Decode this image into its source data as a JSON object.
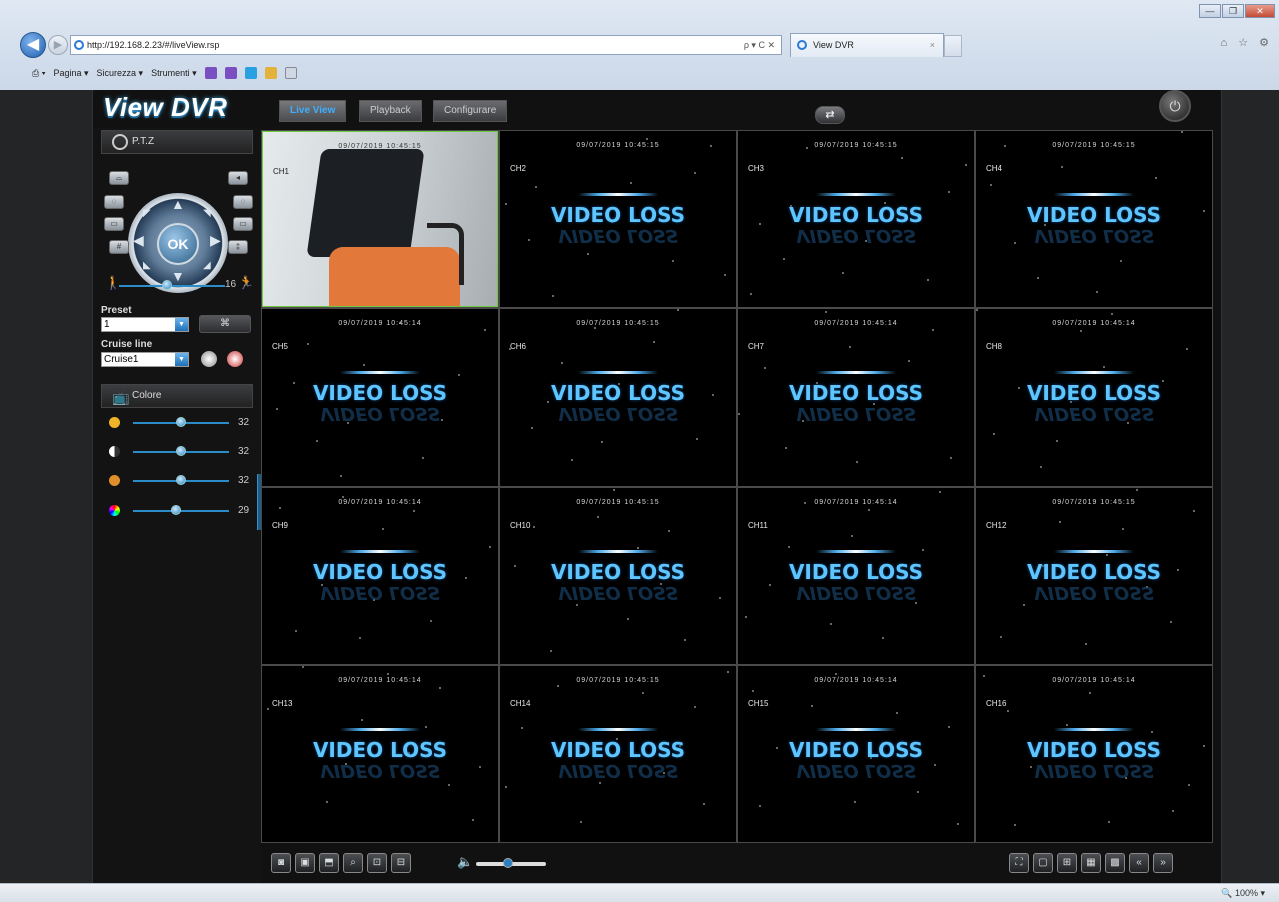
{
  "browser": {
    "url": "http://192.168.2.23/#/liveView.rsp",
    "tab_title": "View DVR",
    "address_controls": "ρ ▾ C ✕",
    "tab_close": "×",
    "window_controls": [
      "—",
      "❐",
      "✕"
    ],
    "fav_icons": "⌂ ☆ ⚙",
    "menu": [
      "Pagina ▾",
      "Sicurezza ▾",
      "Strumenti ▾"
    ],
    "zoom": "100%"
  },
  "app": {
    "logo": "View DVR",
    "tabs": [
      "Live View",
      "Playback",
      "Configurare"
    ],
    "active_tab": "Live View",
    "switch_glyph": "⇄",
    "power_glyph": "⏻"
  },
  "ptz": {
    "title": "P.T.Z",
    "ok": "OK",
    "speed_value": "16",
    "preset_label": "Preset",
    "preset_value": "1",
    "preset_go": "⌘",
    "cruise_label": "Cruise line",
    "cruise_value": "Cruise1"
  },
  "color": {
    "title": "Colore",
    "brightness": {
      "value": "32",
      "level": 0.5
    },
    "contrast": {
      "value": "32",
      "level": 0.5
    },
    "saturation": {
      "value": "32",
      "level": 0.5
    },
    "hue": {
      "value": "29",
      "level": 0.45
    }
  },
  "speed_level": 0.45,
  "grid": {
    "channels": [
      {
        "ch": "CH1",
        "ts": "09/07/2019 10:45:15",
        "live": true
      },
      {
        "ch": "CH2",
        "ts": "09/07/2019 10:45:15"
      },
      {
        "ch": "CH3",
        "ts": "09/07/2019 10:45:15"
      },
      {
        "ch": "CH4",
        "ts": "09/07/2019 10:45:15"
      },
      {
        "ch": "CH5",
        "ts": "09/07/2019 10:45:14"
      },
      {
        "ch": "CH6",
        "ts": "09/07/2019 10:45:15"
      },
      {
        "ch": "CH7",
        "ts": "09/07/2019 10:45:14"
      },
      {
        "ch": "CH8",
        "ts": "09/07/2019 10:45:14"
      },
      {
        "ch": "CH9",
        "ts": "09/07/2019 10:45:14"
      },
      {
        "ch": "CH10",
        "ts": "09/07/2019 10:45:15"
      },
      {
        "ch": "CH11",
        "ts": "09/07/2019 10:45:14"
      },
      {
        "ch": "CH12",
        "ts": "09/07/2019 10:45:15"
      },
      {
        "ch": "CH13",
        "ts": "09/07/2019 10:45:14"
      },
      {
        "ch": "CH14",
        "ts": "09/07/2019 10:45:15"
      },
      {
        "ch": "CH15",
        "ts": "09/07/2019 10:45:14"
      },
      {
        "ch": "CH16",
        "ts": "09/07/2019 10:45:14"
      }
    ],
    "video_loss_text": "VIDEO LOSS"
  },
  "toolbar": {
    "volume_level": 0.45,
    "left_icons": [
      "snapshot-icon",
      "record-icon",
      "save-icon",
      "search-icon",
      "display-icon",
      "stream-icon"
    ],
    "right_icons": [
      "fullscreen-icon",
      "single-view-icon",
      "quad-view-icon",
      "nine-view-icon",
      "sixteen-view-icon",
      "prev-page-icon",
      "next-page-icon"
    ]
  }
}
